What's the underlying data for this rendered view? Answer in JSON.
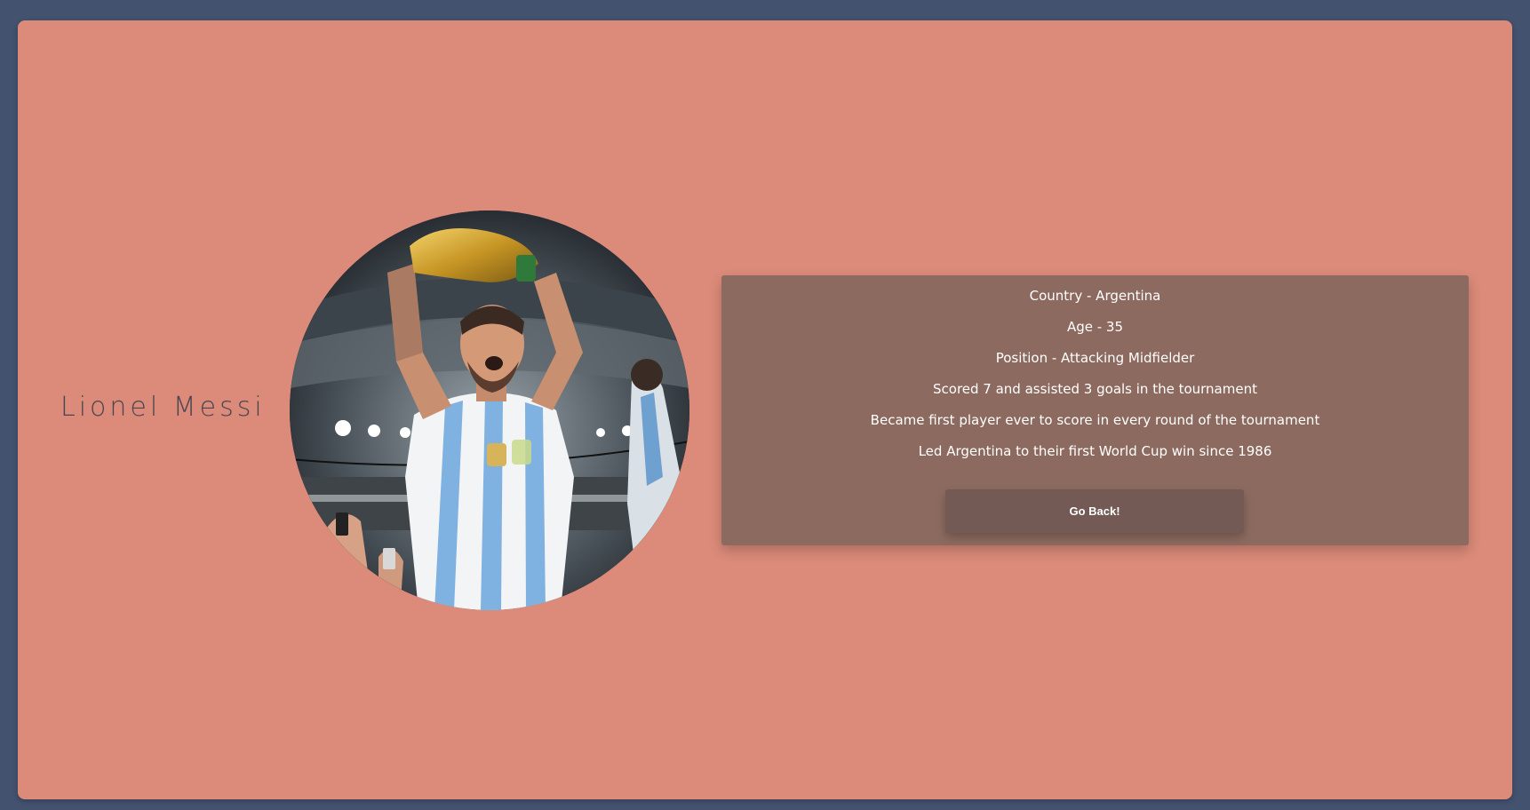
{
  "player": {
    "name": "Lionel Messi"
  },
  "info": {
    "lines": [
      "Country - Argentina",
      "Age - 35",
      "Position - Attacking Midfielder",
      "Scored 7 and assisted 3 goals in the tournament",
      "Became first player ever to score in every round of the tournament",
      "Led Argentina to their first World Cup win since 1986"
    ],
    "back_label": "Go Back!"
  },
  "colors": {
    "page_background": "#43526f",
    "card_background": "#dc8b7a",
    "panel_background": "#8c6a5f",
    "button_background": "#745a54",
    "name_text": "#4a4651"
  }
}
